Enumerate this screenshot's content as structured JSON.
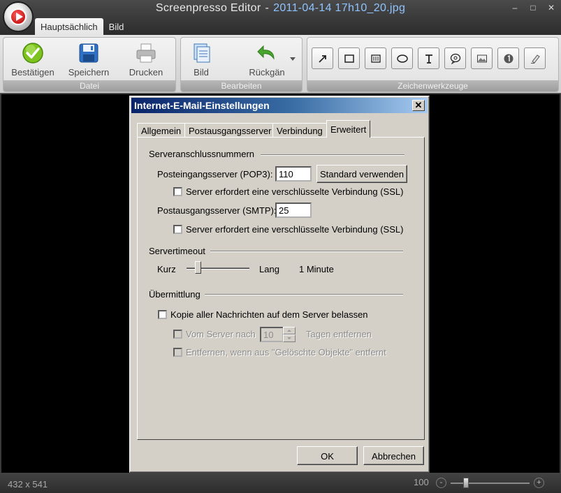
{
  "window": {
    "app_name": "Screenpresso Editor",
    "separator": "-",
    "file_name": "2011-04-14 17h10_20.jpg",
    "controls": {
      "minimize": "–",
      "maximize": "□",
      "close": "✕"
    }
  },
  "tabs": [
    {
      "label": "Hauptsächlich",
      "active": true
    },
    {
      "label": "Bild",
      "active": false
    }
  ],
  "ribbon": {
    "groups": [
      {
        "label": "Datei"
      },
      {
        "label": "Bearbeiten"
      },
      {
        "label": "Zeichenwerkzeuge"
      }
    ],
    "buttons": {
      "confirm": {
        "label": "Bestätigen",
        "icon": "checkmark-icon"
      },
      "save": {
        "label": "Speichern",
        "icon": "floppy-disk-icon"
      },
      "print": {
        "label": "Drucken",
        "icon": "printer-icon"
      },
      "image": {
        "label": "Bild",
        "icon": "image-stack-icon"
      },
      "undo": {
        "label": "Rückgän",
        "icon": "undo-arrow-icon"
      }
    },
    "tools": [
      {
        "icon": "arrow-tool-icon"
      },
      {
        "icon": "rectangle-tool-icon"
      },
      {
        "icon": "blur-rectangle-tool-icon"
      },
      {
        "icon": "ellipse-tool-icon"
      },
      {
        "icon": "text-tool-icon"
      },
      {
        "icon": "callout-tool-icon"
      },
      {
        "icon": "picture-tool-icon"
      },
      {
        "icon": "numbered-step-tool-icon"
      },
      {
        "icon": "highlighter-tool-icon"
      }
    ]
  },
  "dialog": {
    "title": "Internet-E-Mail-Einstellungen",
    "close_label": "✕",
    "tabs": [
      {
        "label": "Allgemein"
      },
      {
        "label": "Postausgangsserver"
      },
      {
        "label": "Verbindung"
      },
      {
        "label": "Erweitert",
        "active": true
      }
    ],
    "ports": {
      "section_title": "Serveranschlussnummern",
      "pop3_label": "Posteingangsserver (POP3):",
      "pop3_value": "110",
      "default_button": "Standard verwenden",
      "pop3_ssl_label": "Server erfordert eine verschlüsselte Verbindung (SSL)",
      "smtp_label": "Postausgangsserver (SMTP):",
      "smtp_value": "25",
      "smtp_ssl_label": "Server erfordert eine verschlüsselte Verbindung (SSL)"
    },
    "timeout": {
      "section_title": "Servertimeout",
      "short_label": "Kurz",
      "long_label": "Lang",
      "value_text": "1 Minute",
      "slider_fraction": 0.15
    },
    "delivery": {
      "section_title": "Übermittlung",
      "keep_copy_label": "Kopie aller Nachrichten auf dem Server belassen",
      "remove_after_prefix": "Vom Server nach",
      "remove_after_days": "10",
      "remove_after_suffix": "Tagen entfernen",
      "remove_deleted_label": "Entfernen, wenn aus \"Gelöschte Objekte\" entfernt"
    },
    "ok_button": "OK",
    "cancel_button": "Abbrechen"
  },
  "status": {
    "dimensions": "432 x 541",
    "zoom_value": "100",
    "zoom_out": "-",
    "zoom_in": "+"
  },
  "colors": {
    "title_text": "#e8e8e8",
    "file_name_text": "#8fc3ff",
    "dialog_title_gradient_start": "#0a246a",
    "dialog_face": "#d4d0c8"
  }
}
